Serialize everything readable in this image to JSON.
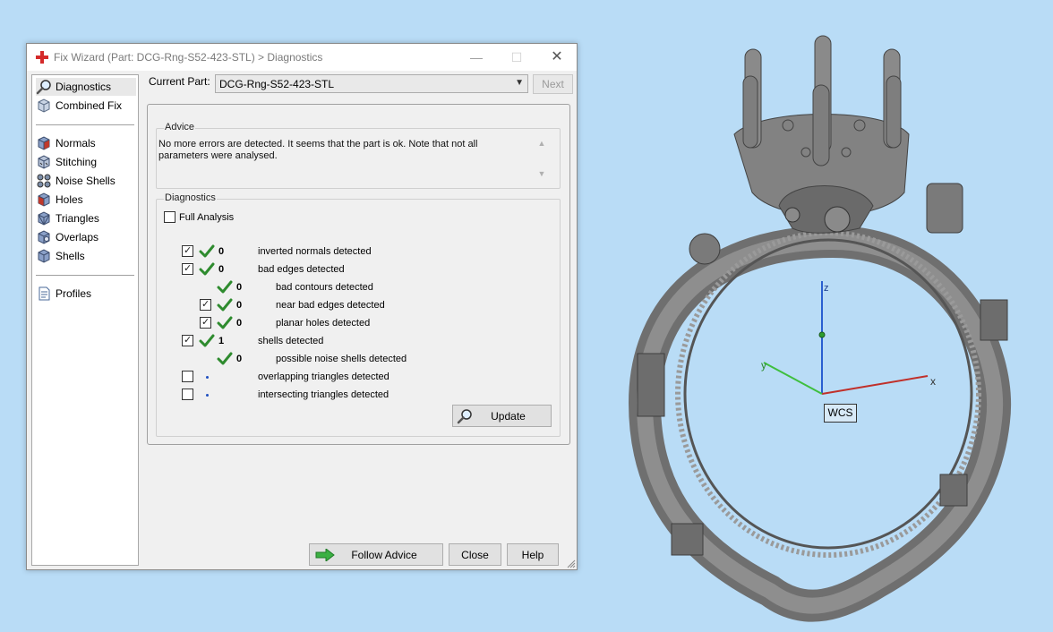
{
  "window": {
    "title": "Fix Wizard (Part: DCG-Rng-S52-423-STL) > Diagnostics",
    "min_glyph": "—",
    "max_glyph": "☐",
    "close_glyph": "✕"
  },
  "nav": {
    "items": [
      {
        "label": "Diagnostics",
        "icon": "magnifier-icon",
        "selected": true
      },
      {
        "label": "Combined Fix",
        "icon": "cube-icon"
      },
      {
        "label": "Normals",
        "icon": "normals-cube-icon"
      },
      {
        "label": "Stitching",
        "icon": "stitching-cube-icon"
      },
      {
        "label": "Noise Shells",
        "icon": "noise-shells-icon"
      },
      {
        "label": "Holes",
        "icon": "holes-cube-icon"
      },
      {
        "label": "Triangles",
        "icon": "triangles-cube-icon"
      },
      {
        "label": "Overlaps",
        "icon": "overlaps-cube-icon"
      },
      {
        "label": "Shells",
        "icon": "shells-cube-icon"
      },
      {
        "label": "Profiles",
        "icon": "document-icon"
      }
    ]
  },
  "current_part": {
    "label": "Current Part:",
    "value": "DCG-Rng-S52-423-STL",
    "next_label": "Next"
  },
  "advice": {
    "legend": "Advice",
    "text": "No more errors are detected. It seems that the part is ok. Note that not all parameters were analysed."
  },
  "diagnostics": {
    "legend": "Diagnostics",
    "full_analysis_label": "Full Analysis",
    "full_analysis_checked": false,
    "rows": [
      {
        "checkbox": "checked",
        "status": "ok",
        "count": "0",
        "label": "inverted normals detected",
        "indent": 0
      },
      {
        "checkbox": "checked",
        "status": "ok",
        "count": "0",
        "label": "bad edges detected",
        "indent": 0
      },
      {
        "checkbox": "none",
        "status": "ok",
        "count": "0",
        "label": "bad contours detected",
        "indent": 1
      },
      {
        "checkbox": "checked",
        "status": "ok",
        "count": "0",
        "label": "near bad edges detected",
        "indent": 1
      },
      {
        "checkbox": "checked",
        "status": "ok",
        "count": "0",
        "label": "planar holes detected",
        "indent": 1
      },
      {
        "checkbox": "checked",
        "status": "ok",
        "count": "1",
        "label": "shells detected",
        "indent": 0
      },
      {
        "checkbox": "none",
        "status": "ok",
        "count": "0",
        "label": "possible noise shells detected",
        "indent": 1
      },
      {
        "checkbox": "unchecked",
        "status": "pending",
        "count": "",
        "label": "overlapping triangles detected",
        "indent": 0
      },
      {
        "checkbox": "unchecked",
        "status": "pending",
        "count": "",
        "label": "intersecting triangles detected",
        "indent": 0
      }
    ],
    "update_label": "Update"
  },
  "footer": {
    "follow_advice_label": "Follow Advice",
    "close_label": "Close",
    "help_label": "Help"
  },
  "viewport": {
    "axis_x": "x",
    "axis_y": "y",
    "axis_z": "z",
    "wcs_label": "WCS",
    "colors": {
      "x_axis": "#c0302a",
      "y_axis": "#3fbf3f",
      "z_axis": "#2a5fd0",
      "model": "#7b7b7b"
    }
  }
}
